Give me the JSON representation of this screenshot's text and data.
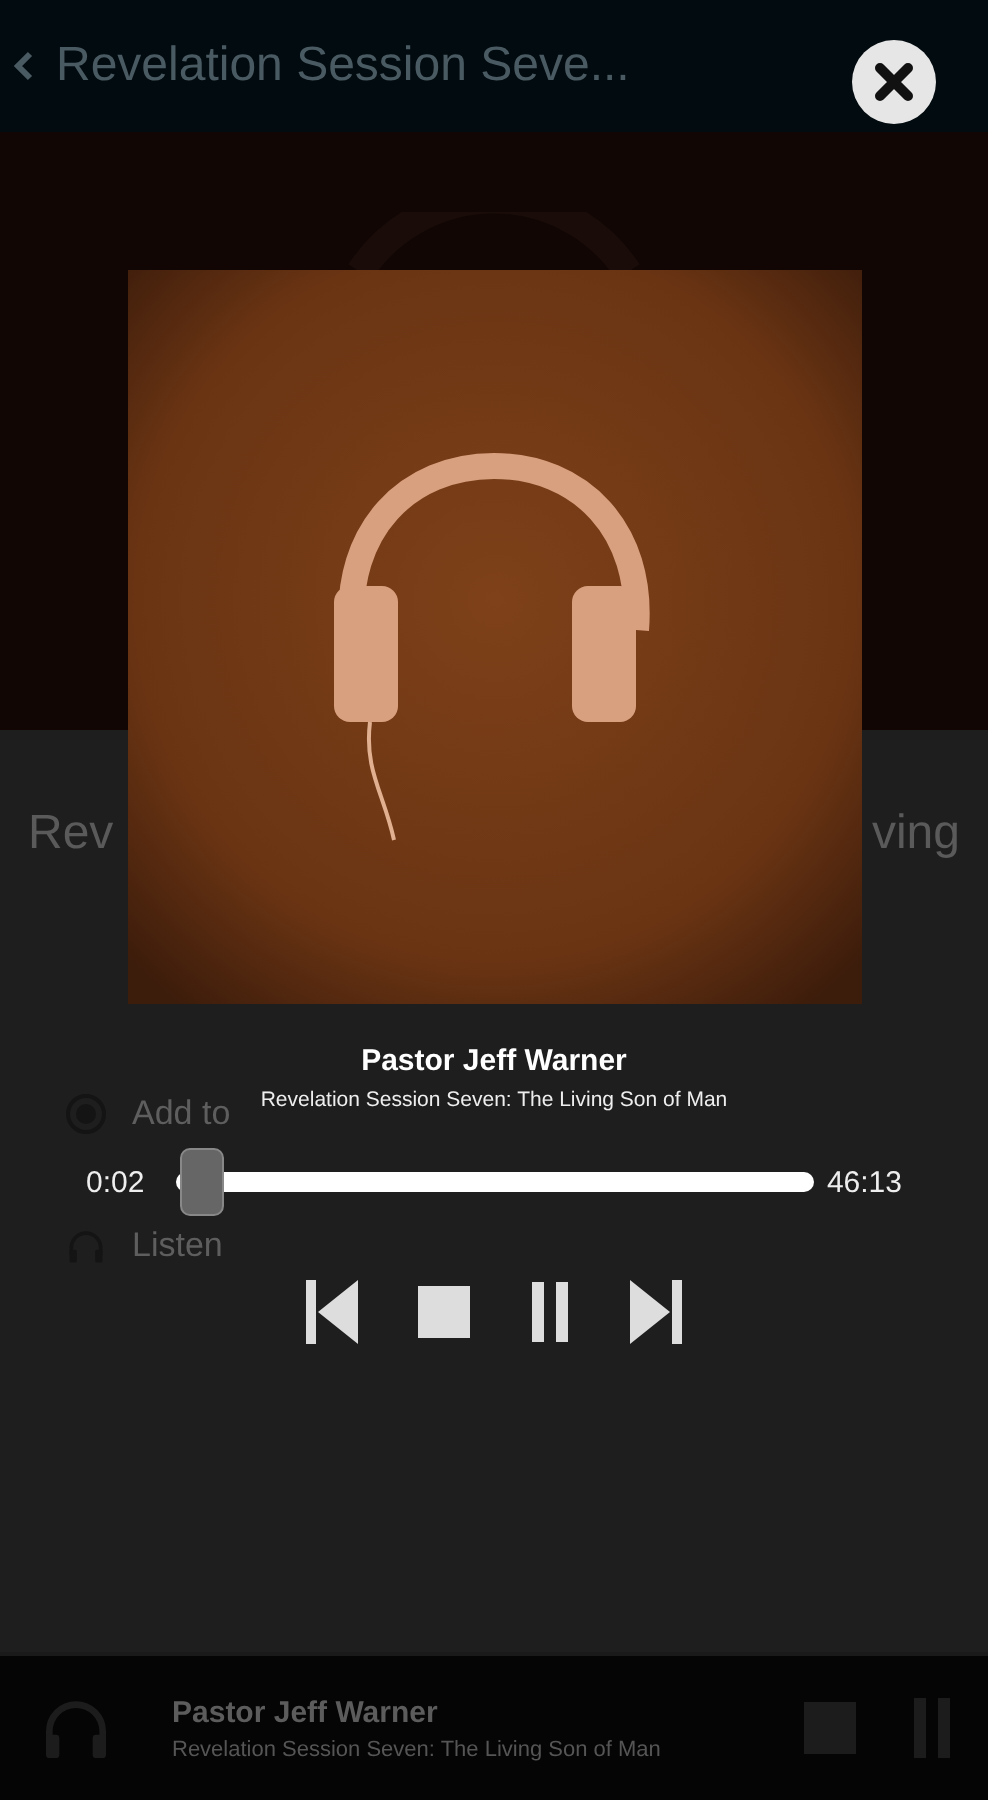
{
  "background": {
    "top_bar": {
      "title": "Revelation Session Seve..."
    },
    "heading_fragments": [
      "Rev",
      "ving"
    ],
    "options": [
      {
        "kind": "radio",
        "label": "Add to"
      },
      {
        "kind": "headphones",
        "label": "Listen"
      }
    ],
    "mini_player": {
      "artist": "Pastor Jeff Warner",
      "title": "Revelation Session Seven: The Living Son of Man"
    }
  },
  "player": {
    "artist": "Pastor Jeff Warner",
    "title": "Revelation Session Seven: The Living Son of Man",
    "elapsed": "0:02",
    "duration": "46:13",
    "level": 0.005,
    "playing": true
  }
}
